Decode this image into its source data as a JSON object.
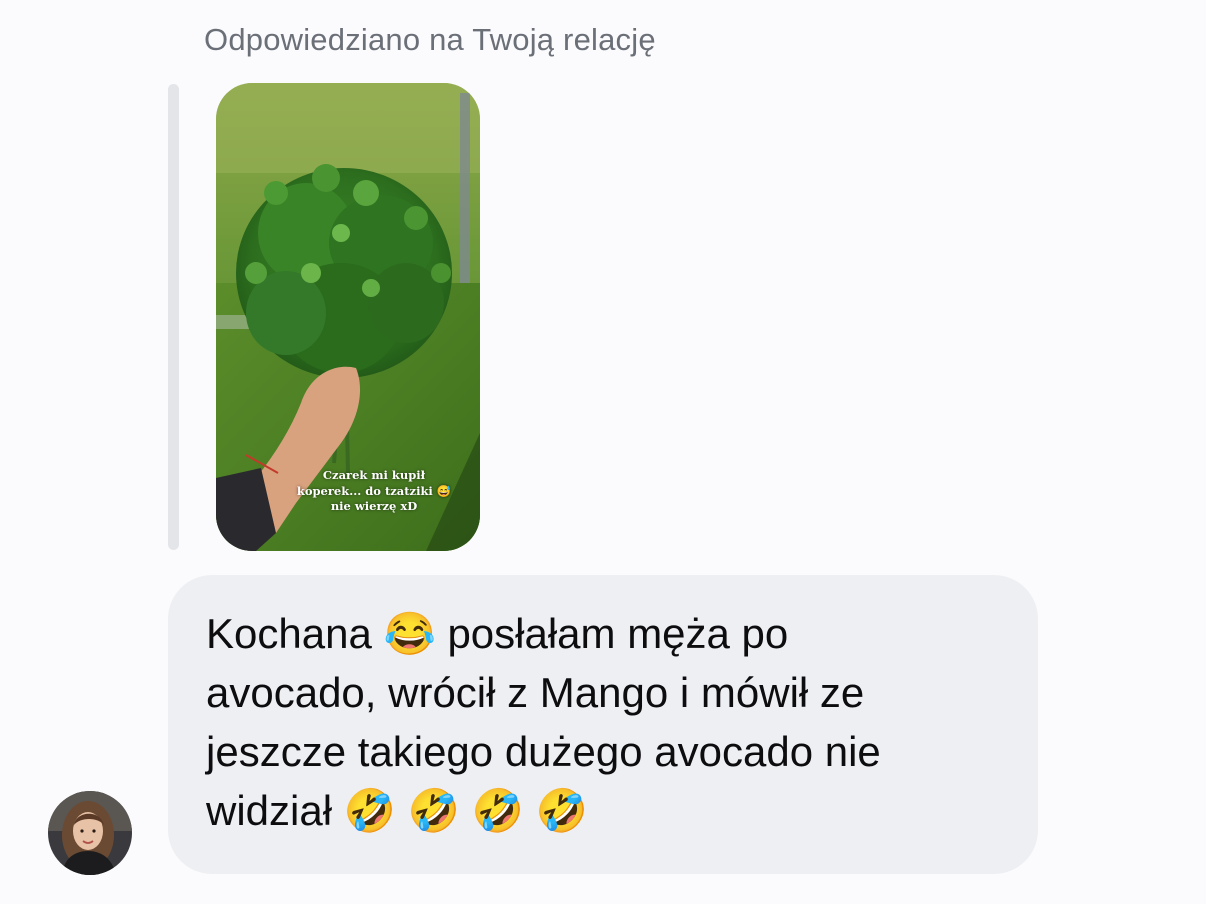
{
  "reply_context": {
    "label": "Odpowiedziano na Twoją relację"
  },
  "story_preview": {
    "caption_lines": [
      "Czarek mi kupił",
      "koperek... do tzatziki 😅",
      "nie wierzę xD"
    ]
  },
  "message": {
    "lines": [
      "Kochana 😂 posłałam męża po",
      "avocado, wrócił z Mango i mówił ze",
      "jeszcze takiego dużego avocado nie",
      "widział 🤣 🤣 🤣 🤣"
    ]
  },
  "colors": {
    "background": "#fbfbfd",
    "bubble": "#eeeff3",
    "header_text": "#6b6f78",
    "quote_bar": "#e4e5e9"
  },
  "icons": {
    "avatar": "sender-avatar-photo"
  }
}
